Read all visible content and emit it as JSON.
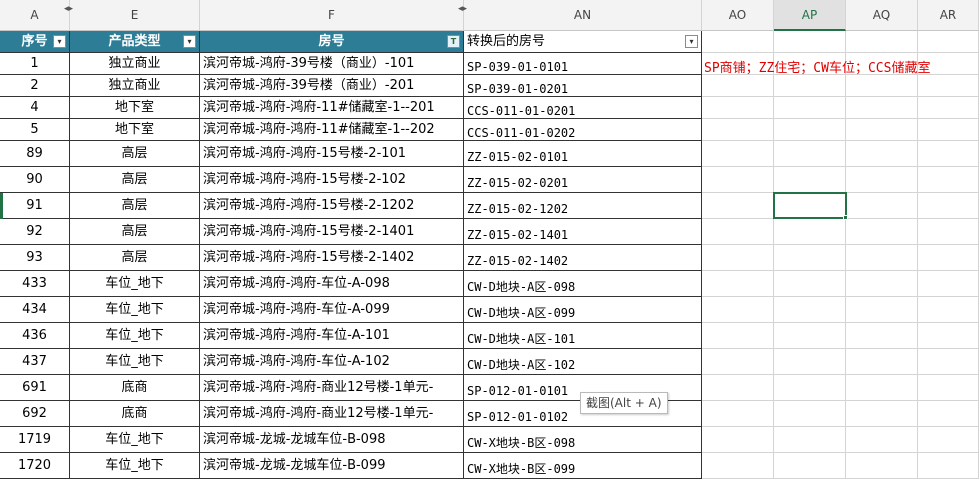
{
  "columns": {
    "A": "A",
    "E": "E",
    "F": "F",
    "AN": "AN",
    "AO": "AO",
    "AP": "AP",
    "AQ": "AQ",
    "AR": "AR",
    "hidden_marker": "◂▸"
  },
  "table": {
    "headers": {
      "seq": "序号",
      "product_type": "产品类型",
      "room_no": "房号",
      "converted": "转换后的房号"
    },
    "filter_icon": "▾",
    "filter_active_icon": "T",
    "rows": [
      {
        "seq": "1",
        "type": "独立商业",
        "room": "滨河帝城-鸿府-39号楼（商业）-101",
        "conv": "SP-039-01-0101"
      },
      {
        "seq": "2",
        "type": "独立商业",
        "room": "滨河帝城-鸿府-39号楼（商业）-201",
        "conv": "SP-039-01-0201"
      },
      {
        "seq": "4",
        "type": "地下室",
        "room": "滨河帝城-鸿府-鸿府-11#储藏室-1--201",
        "conv": "CCS-011-01-0201"
      },
      {
        "seq": "5",
        "type": "地下室",
        "room": "滨河帝城-鸿府-鸿府-11#储藏室-1--202",
        "conv": "CCS-011-01-0202"
      },
      {
        "seq": "89",
        "type": "高层",
        "room": "滨河帝城-鸿府-鸿府-15号楼-2-101",
        "conv": "ZZ-015-02-0101"
      },
      {
        "seq": "90",
        "type": "高层",
        "room": "滨河帝城-鸿府-鸿府-15号楼-2-102",
        "conv": "ZZ-015-02-0201"
      },
      {
        "seq": "91",
        "type": "高层",
        "room": "滨河帝城-鸿府-鸿府-15号楼-2-1202",
        "conv": "ZZ-015-02-1202"
      },
      {
        "seq": "92",
        "type": "高层",
        "room": "滨河帝城-鸿府-鸿府-15号楼-2-1401",
        "conv": "ZZ-015-02-1401"
      },
      {
        "seq": "93",
        "type": "高层",
        "room": "滨河帝城-鸿府-鸿府-15号楼-2-1402",
        "conv": "ZZ-015-02-1402"
      },
      {
        "seq": "433",
        "type": "车位_地下",
        "room": "滨河帝城-鸿府-鸿府-车位-A-098",
        "conv": "CW-D地块-A区-098"
      },
      {
        "seq": "434",
        "type": "车位_地下",
        "room": "滨河帝城-鸿府-鸿府-车位-A-099",
        "conv": "CW-D地块-A区-099"
      },
      {
        "seq": "436",
        "type": "车位_地下",
        "room": "滨河帝城-鸿府-鸿府-车位-A-101",
        "conv": "CW-D地块-A区-101"
      },
      {
        "seq": "437",
        "type": "车位_地下",
        "room": "滨河帝城-鸿府-鸿府-车位-A-102",
        "conv": "CW-D地块-A区-102"
      },
      {
        "seq": "691",
        "type": "底商",
        "room": "滨河帝城-鸿府-鸿府-商业12号楼-1单元-",
        "conv": "SP-012-01-0101"
      },
      {
        "seq": "692",
        "type": "底商",
        "room": "滨河帝城-鸿府-鸿府-商业12号楼-1单元-",
        "conv": "SP-012-01-0102"
      },
      {
        "seq": "1719",
        "type": "车位_地下",
        "room": "滨河帝城-龙城-龙城车位-B-098",
        "conv": "CW-X地块-B区-098"
      },
      {
        "seq": "1720",
        "type": "车位_地下",
        "room": "滨河帝城-龙城-龙城车位-B-099",
        "conv": "CW-X地块-B区-099"
      }
    ]
  },
  "legend_text": "SP商铺；ZZ住宅；CW车位；CCS储藏室",
  "tooltip": "截图(Alt + A)",
  "colors": {
    "header_bg": "#2e7d96",
    "selection": "#217346",
    "legend": "#e00000"
  }
}
